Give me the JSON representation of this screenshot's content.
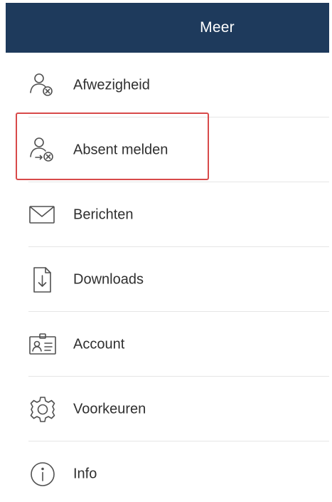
{
  "header": {
    "title": "Meer"
  },
  "menu": {
    "items": [
      {
        "label": "Afwezigheid",
        "icon": "person-absence-icon"
      },
      {
        "label": "Absent melden",
        "icon": "person-report-absent-icon"
      },
      {
        "label": "Berichten",
        "icon": "envelope-icon"
      },
      {
        "label": "Downloads",
        "icon": "download-document-icon"
      },
      {
        "label": "Account",
        "icon": "id-card-icon"
      },
      {
        "label": "Voorkeuren",
        "icon": "gear-icon"
      },
      {
        "label": "Info",
        "icon": "info-icon"
      }
    ],
    "highlighted_item": "Absent melden"
  },
  "colors": {
    "header_background": "#1e3a5c",
    "header_text": "#ffffff",
    "highlight_border": "#d84a4a",
    "icon_stroke": "#505050"
  }
}
